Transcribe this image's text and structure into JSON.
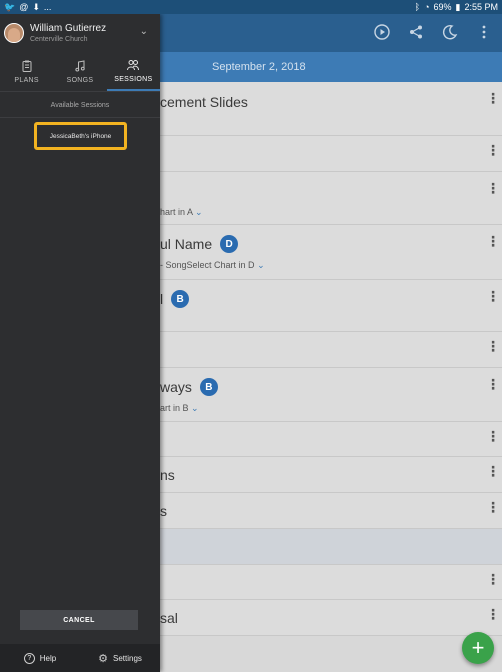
{
  "statusbar": {
    "left_icons": [
      "twitter-icon",
      "at-icon",
      "download-icon",
      "more-icon"
    ],
    "battery": "69%",
    "time": "2:55 PM",
    "more": "..."
  },
  "plan": {
    "date": "September 2, 2018",
    "rows": [
      {
        "title": "cement Slides",
        "sub": "",
        "badge": ""
      },
      {
        "title": "",
        "sub": "",
        "badge": ""
      },
      {
        "title": "",
        "sub": "hart in A",
        "badge": ""
      },
      {
        "title": "ul Name",
        "sub": "- SongSelect Chart in D",
        "badge": "D"
      },
      {
        "title": "l",
        "sub": "",
        "badge": "B"
      },
      {
        "title": "",
        "sub": "",
        "badge": ""
      },
      {
        "title": "ways",
        "sub": "art in B",
        "badge": "B"
      },
      {
        "title": "",
        "sub": "",
        "badge": ""
      },
      {
        "title": "ns",
        "sub": "",
        "badge": ""
      },
      {
        "title": "s",
        "sub": "",
        "badge": ""
      },
      {
        "title": "",
        "sub": "",
        "badge": ""
      },
      {
        "title": "",
        "sub": "",
        "badge": ""
      },
      {
        "title": "sal",
        "sub": "",
        "badge": ""
      }
    ]
  },
  "drawer": {
    "user_name": "William Gutierrez",
    "church": "Centerville Church",
    "tabs": [
      {
        "label": "PLANS",
        "icon": "clipboard-icon"
      },
      {
        "label": "SONGS",
        "icon": "music-note-icon"
      },
      {
        "label": "SESSIONS",
        "icon": "people-icon"
      }
    ],
    "sessions_header": "Available Sessions",
    "session_item": "JessicaBeth's iPhone",
    "cancel_label": "CANCEL",
    "help_label": "Help",
    "settings_label": "Settings"
  },
  "colors": {
    "accent": "#3d7bb5",
    "highlight": "#f2b321",
    "fab": "#3aa24a"
  }
}
